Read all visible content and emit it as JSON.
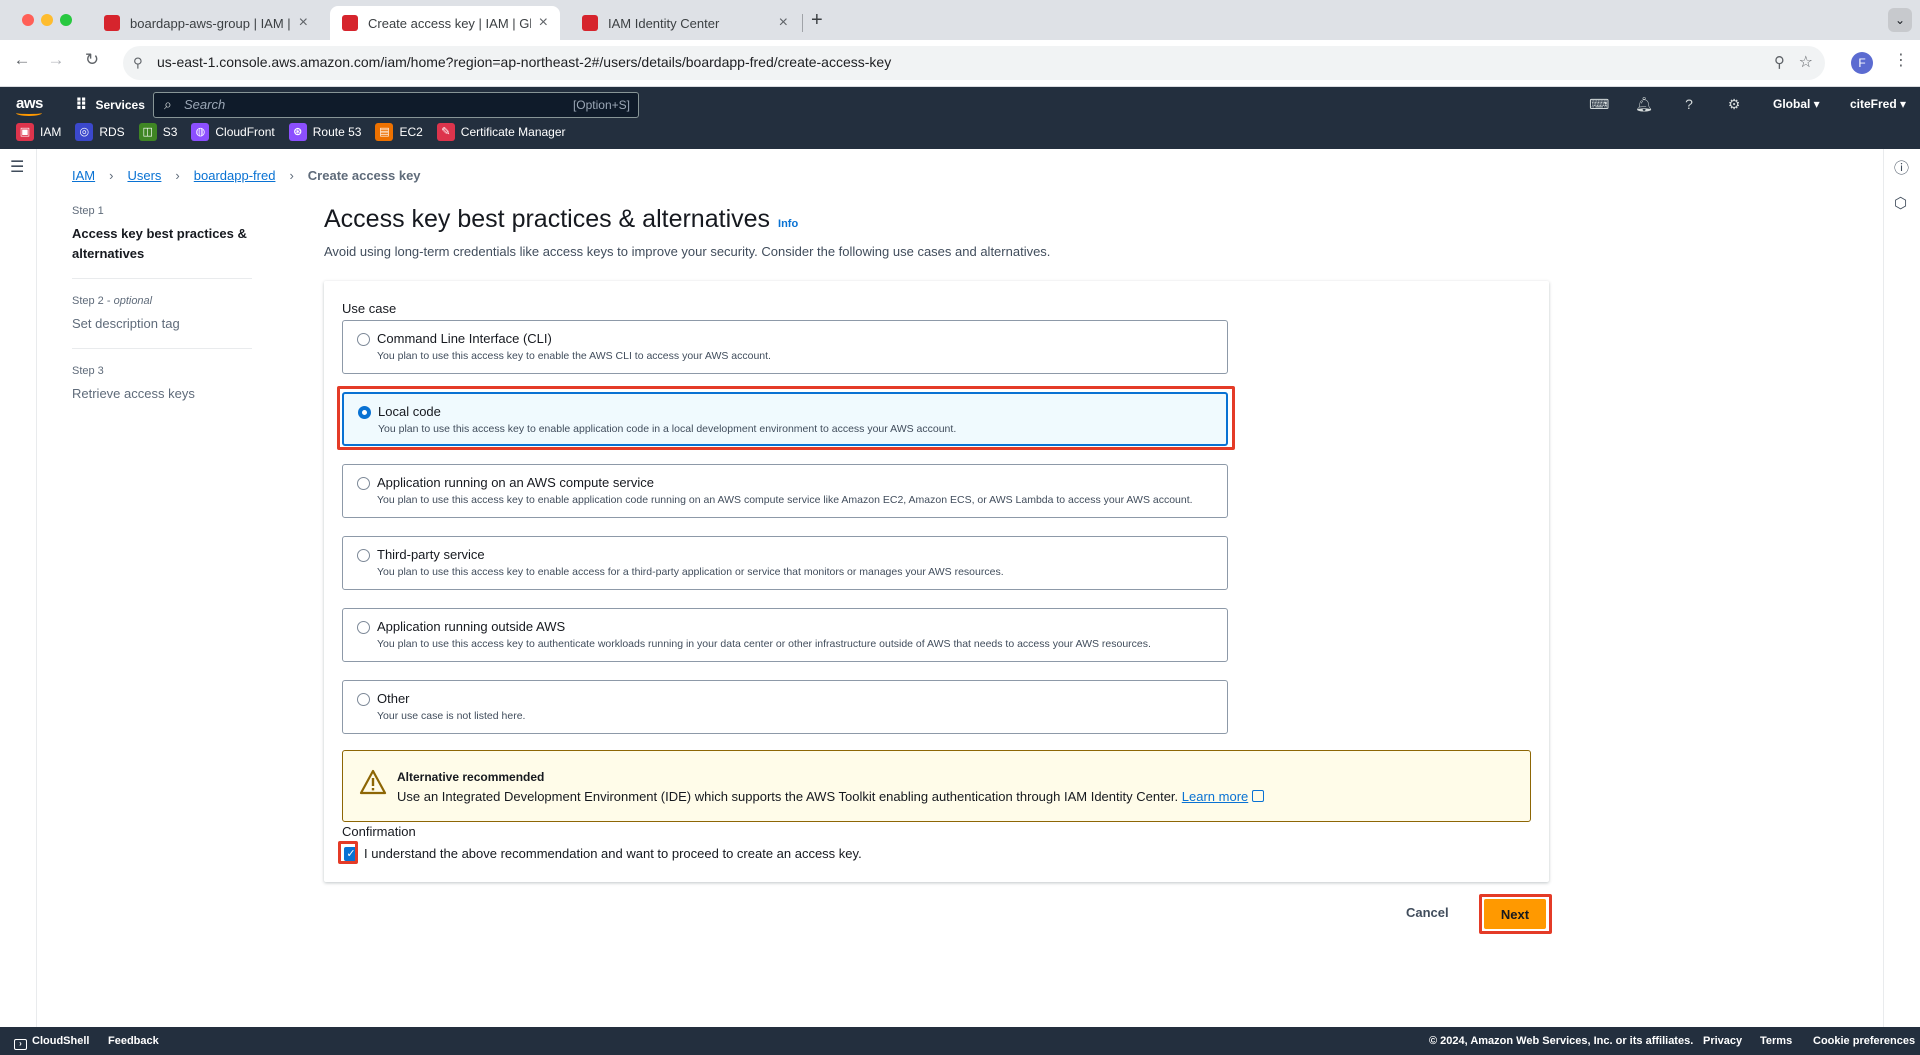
{
  "browser": {
    "tabs": [
      {
        "label": "boardapp-aws-group | IAM | Gl",
        "color": "#d6242d"
      },
      {
        "label": "Create access key | IAM | Glob",
        "color": "#d6242d"
      },
      {
        "label": "IAM Identity Center",
        "color": "#d6242d"
      }
    ],
    "url": "us-east-1.console.aws.amazon.com/iam/home?region=ap-northeast-2#/users/details/boardapp-fred/create-access-key",
    "profile_initial": "F"
  },
  "aws_nav": {
    "logo": "aws",
    "services_label": "Services",
    "search_placeholder": "Search",
    "search_shortcut": "[Option+S]",
    "region": "Global ▾",
    "account": "citeFred ▾",
    "favorites": [
      {
        "label": "IAM",
        "color": "#dd344c",
        "icon": "iam-icon"
      },
      {
        "label": "RDS",
        "color": "#3b48cc",
        "icon": "rds-icon"
      },
      {
        "label": "S3",
        "color": "#3f8624",
        "icon": "s3-icon"
      },
      {
        "label": "CloudFront",
        "color": "#8c4fff",
        "icon": "cloudfront-icon"
      },
      {
        "label": "Route 53",
        "color": "#8c4fff",
        "icon": "route53-icon"
      },
      {
        "label": "EC2",
        "color": "#ed7100",
        "icon": "ec2-icon"
      },
      {
        "label": "Certificate Manager",
        "color": "#dd344c",
        "icon": "certificate-manager-icon"
      }
    ]
  },
  "breadcrumb": {
    "items": [
      "IAM",
      "Users",
      "boardapp-fred"
    ],
    "current": "Create access key"
  },
  "steps": [
    {
      "number": "Step 1",
      "optional": "",
      "name": "Access key best practices & alternatives"
    },
    {
      "number": "Step 2 - ",
      "optional": "optional",
      "name": "Set description tag"
    },
    {
      "number": "Step 3",
      "optional": "",
      "name": "Retrieve access keys"
    }
  ],
  "page": {
    "title": "Access key best practices & alternatives",
    "info": "Info",
    "subtitle": "Avoid using long-term credentials like access keys to improve your security. Consider the following use cases and alternatives."
  },
  "use_case": {
    "label": "Use case",
    "selected_index": 1,
    "options": [
      {
        "title": "Command Line Interface (CLI)",
        "description": "You plan to use this access key to enable the AWS CLI to access your AWS account."
      },
      {
        "title": "Local code",
        "description": "You plan to use this access key to enable application code in a local development environment to access your AWS account."
      },
      {
        "title": "Application running on an AWS compute service",
        "description": "You plan to use this access key to enable application code running on an AWS compute service like Amazon EC2, Amazon ECS, or AWS Lambda to access your AWS account."
      },
      {
        "title": "Third-party service",
        "description": "You plan to use this access key to enable access for a third-party application or service that monitors or manages your AWS resources."
      },
      {
        "title": "Application running outside AWS",
        "description": "You plan to use this access key to authenticate workloads running in your data center or other infrastructure outside of AWS that needs to access your AWS resources."
      },
      {
        "title": "Other",
        "description": "Your use case is not listed here."
      }
    ]
  },
  "alert": {
    "title": "Alternative recommended",
    "body": "Use an Integrated Development Environment (IDE) which supports the AWS Toolkit enabling authentication through IAM Identity Center.",
    "link": "Learn more"
  },
  "confirmation": {
    "label": "Confirmation",
    "checkbox_text": "I understand the above recommendation and want to proceed to create an access key.",
    "checked": true
  },
  "actions": {
    "cancel": "Cancel",
    "next": "Next"
  },
  "footer": {
    "cloudshell": "CloudShell",
    "feedback": "Feedback",
    "copyright": "© 2024, Amazon Web Services, Inc. or its affiliates.",
    "privacy": "Privacy",
    "terms": "Terms",
    "cookie": "Cookie preferences"
  },
  "colors": {
    "accent": "#0972d3",
    "primary_button": "#ff9900",
    "nav_bg": "#232f3e",
    "highlight": "#e43b27",
    "warning_bg": "#fffce9"
  }
}
